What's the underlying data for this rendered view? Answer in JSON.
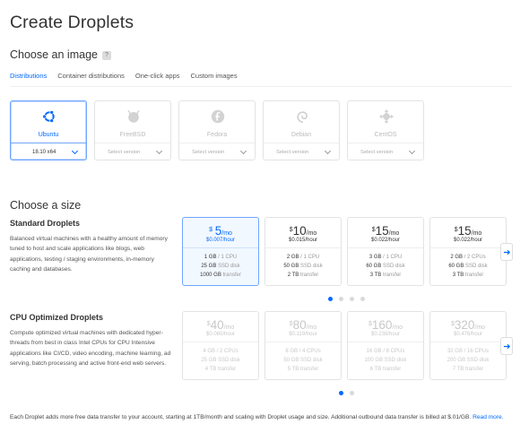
{
  "page": {
    "title": "Create Droplets"
  },
  "image_section": {
    "heading": "Choose an image",
    "help_icon": "?",
    "tabs": [
      {
        "label": "Distributions",
        "active": true
      },
      {
        "label": "Container distributions",
        "active": false
      },
      {
        "label": "One-click apps",
        "active": false
      },
      {
        "label": "Custom images",
        "active": false
      }
    ],
    "distributions": [
      {
        "name": "Ubuntu",
        "version": "18.10 x64",
        "icon": "ubuntu-icon",
        "selected": true
      },
      {
        "name": "FreeBSD",
        "version": "Select version",
        "icon": "freebsd-icon",
        "selected": false
      },
      {
        "name": "Fedora",
        "version": "Select version",
        "icon": "fedora-icon",
        "selected": false
      },
      {
        "name": "Debian",
        "version": "Select version",
        "icon": "debian-icon",
        "selected": false
      },
      {
        "name": "CentOS",
        "version": "Select version",
        "icon": "centos-icon",
        "selected": false
      }
    ]
  },
  "size_section": {
    "heading": "Choose a size",
    "standard": {
      "title": "Standard Droplets",
      "description": "Balanced virtual machines with a healthy amount of memory tuned to host and scale applications like blogs, web applications, testing / staging environments, in-memory caching and databases.",
      "plans": [
        {
          "price": "5",
          "per_month": "/mo",
          "hourly": "$0.007/hour",
          "memory": "1 GB",
          "cpu": "1 CPU",
          "disk": "25 GB",
          "disk_label": "SSD disk",
          "transfer": "1000 GB",
          "transfer_label": "transfer",
          "selected": true
        },
        {
          "price": "10",
          "per_month": "/mo",
          "hourly": "$0.015/hour",
          "memory": "2 GB",
          "cpu": "1 CPU",
          "disk": "50 GB",
          "disk_label": "SSD disk",
          "transfer": "2 TB",
          "transfer_label": "transfer",
          "selected": false
        },
        {
          "price": "15",
          "per_month": "/mo",
          "hourly": "$0.022/hour",
          "memory": "3 GB",
          "cpu": "1 CPU",
          "disk": "60 GB",
          "disk_label": "SSD disk",
          "transfer": "3 TB",
          "transfer_label": "transfer",
          "selected": false
        },
        {
          "price": "15",
          "per_month": "/mo",
          "hourly": "$0.022/hour",
          "memory": "2 GB",
          "cpu": "2 CPUs",
          "disk": "60 GB",
          "disk_label": "SSD disk",
          "transfer": "3 TB",
          "transfer_label": "transfer",
          "selected": false
        }
      ],
      "page_dots": 4,
      "active_dot": 0
    },
    "cpu": {
      "title": "CPU Optimized Droplets",
      "description": "Compute optimized virtual machines with dedicated hyper-threads from best in class Intel CPUs for CPU Intensive applications like CI/CD, video encoding, machine learning, ad serving, batch processing and active front-end web servers.",
      "plans": [
        {
          "price": "40",
          "per_month": "/mo",
          "hourly": "$0.060/hour",
          "memory": "4 GB",
          "cpu": "2 CPUs",
          "disk": "25 GB",
          "disk_label": "SSD disk",
          "transfer": "4 TB",
          "transfer_label": "transfer"
        },
        {
          "price": "80",
          "per_month": "/mo",
          "hourly": "$0.119/hour",
          "memory": "8 GB",
          "cpu": "4 CPUs",
          "disk": "50 GB",
          "disk_label": "SSD disk",
          "transfer": "5 TB",
          "transfer_label": "transfer"
        },
        {
          "price": "160",
          "per_month": "/mo",
          "hourly": "$0.238/hour",
          "memory": "16 GB",
          "cpu": "8 CPUs",
          "disk": "100 GB",
          "disk_label": "SSD disk",
          "transfer": "6 TB",
          "transfer_label": "transfer"
        },
        {
          "price": "320",
          "per_month": "/mo",
          "hourly": "$0.476/hour",
          "memory": "32 GB",
          "cpu": "16 CPUs",
          "disk": "200 GB",
          "disk_label": "SSD disk",
          "transfer": "7 TB",
          "transfer_label": "transfer"
        }
      ],
      "page_dots": 2,
      "active_dot": 0
    }
  },
  "footer": {
    "text": "Each Droplet adds more free data transfer to your account, starting at 1TB/month and scaling with Droplet usage and size. Additional outbound data transfer is billed at $.01/GB.",
    "link": "Read more."
  },
  "colors": {
    "accent": "#0069ff",
    "selected_border": "#6fa6ff",
    "selected_bg": "#f2f8ff"
  }
}
